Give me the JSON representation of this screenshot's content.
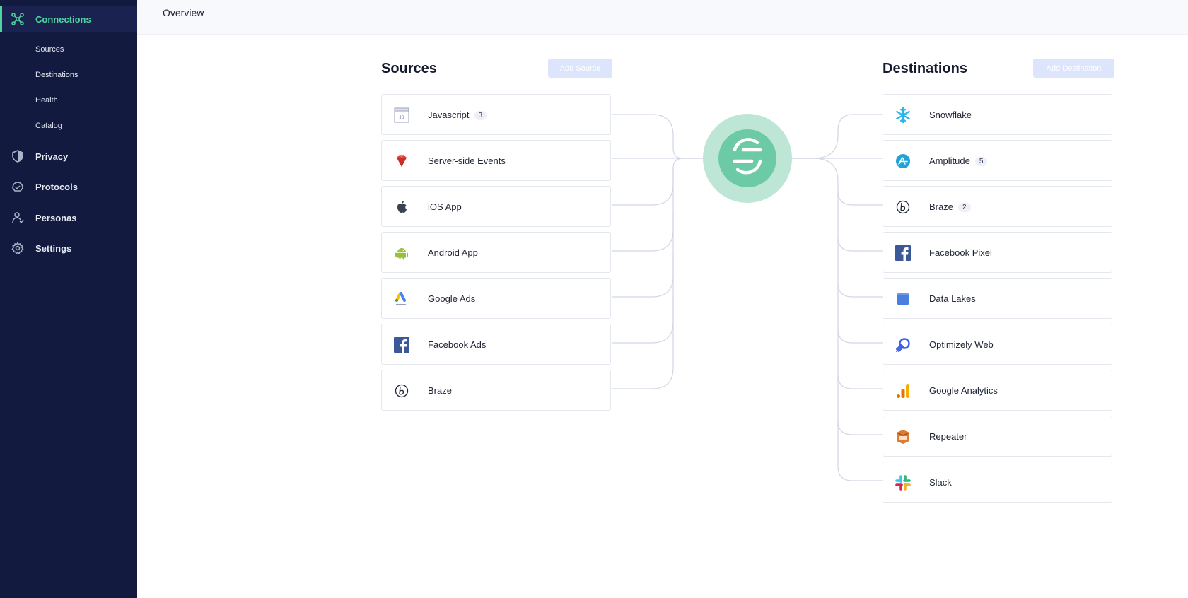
{
  "sidebar": {
    "connections_label": "Connections",
    "sub_items": [
      "Sources",
      "Destinations",
      "Health",
      "Catalog"
    ],
    "privacy_label": "Privacy",
    "protocols_label": "Protocols",
    "personas_label": "Personas",
    "settings_label": "Settings"
  },
  "topbar": {
    "title": "Overview"
  },
  "sources": {
    "title": "Sources",
    "add_label": "Add Source",
    "items": [
      {
        "name": "Javascript",
        "badge": "3",
        "icon": "javascript-icon"
      },
      {
        "name": "Server-side Events",
        "badge": "",
        "icon": "ruby-gem-icon"
      },
      {
        "name": "iOS App",
        "badge": "",
        "icon": "apple-icon"
      },
      {
        "name": "Android App",
        "badge": "",
        "icon": "android-icon"
      },
      {
        "name": "Google Ads",
        "badge": "",
        "icon": "google-ads-icon"
      },
      {
        "name": "Facebook Ads",
        "badge": "",
        "icon": "facebook-icon"
      },
      {
        "name": "Braze",
        "badge": "",
        "icon": "braze-icon"
      }
    ]
  },
  "destinations": {
    "title": "Destinations",
    "add_label": "Add Destination",
    "items": [
      {
        "name": "Snowflake",
        "badge": "",
        "icon": "snowflake-icon"
      },
      {
        "name": "Amplitude",
        "badge": "5",
        "icon": "amplitude-icon"
      },
      {
        "name": "Braze",
        "badge": "2",
        "icon": "braze-icon"
      },
      {
        "name": "Facebook Pixel",
        "badge": "",
        "icon": "facebook-icon"
      },
      {
        "name": "Data Lakes",
        "badge": "",
        "icon": "data-lakes-icon"
      },
      {
        "name": "Optimizely Web",
        "badge": "",
        "icon": "optimizely-icon"
      },
      {
        "name": "Google Analytics",
        "badge": "",
        "icon": "google-analytics-icon"
      },
      {
        "name": "Repeater",
        "badge": "",
        "icon": "repeater-icon"
      },
      {
        "name": "Slack",
        "badge": "",
        "icon": "slack-icon"
      }
    ]
  },
  "colors": {
    "sidebar_bg": "#121a40",
    "accent": "#4fd3a0",
    "hub_outer": "#bde6d6",
    "hub_inner": "#6ccba6",
    "add_button_bg": "#dce5fb",
    "wire": "#d2d6e4"
  }
}
